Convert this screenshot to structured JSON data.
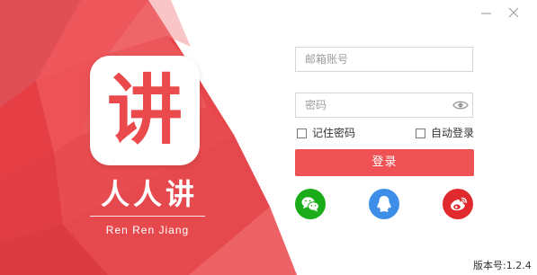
{
  "brand": {
    "logo_char": "讲",
    "name": "人人讲",
    "pinyin": "Ren Ren Jiang"
  },
  "window_controls": {
    "minimize_icon": "minimize-icon",
    "close_icon": "close-icon"
  },
  "login": {
    "email_placeholder": "邮箱账号",
    "password_placeholder": "密码",
    "remember_label": "记住密码",
    "auto_login_label": "自动登录",
    "submit_label": "登录"
  },
  "social": [
    {
      "name": "wechat",
      "icon": "wechat-icon",
      "color": "#1aad19"
    },
    {
      "name": "qq",
      "icon": "qq-icon",
      "color": "#3d8ee8"
    },
    {
      "name": "weibo",
      "icon": "weibo-icon",
      "color": "#e02a2e"
    }
  ],
  "version": "版本号:1.2.4",
  "colors": {
    "accent": "#ef5254",
    "art_red": "#e8474b"
  }
}
